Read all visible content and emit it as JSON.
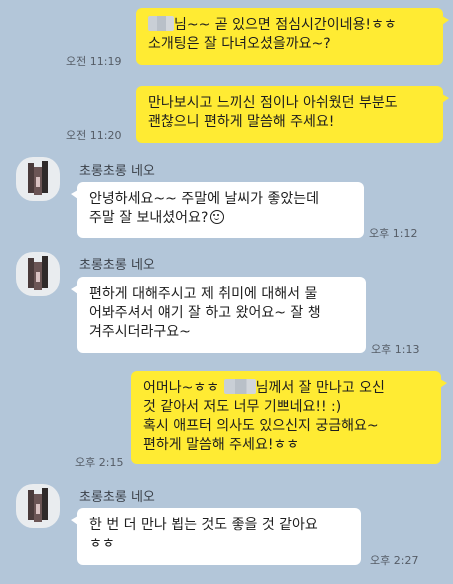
{
  "colors": {
    "background": "#b3c6d9",
    "my_bubble": "#ffeb33",
    "other_bubble": "#ffffff"
  },
  "messages": [
    {
      "from": "me",
      "line1_suffix": "님~~ 곧 있으면 점심시간이네용!ㅎㅎ",
      "line2": "소개팅은 잘 다녀오셨을까요~?",
      "time": "오전 11:19"
    },
    {
      "from": "me",
      "text": "만나보시고 느끼신 점이나 아쉬웠던 부분도\n괜찮으니 편하게 말씀해 주세요!",
      "time": "오전 11:20"
    },
    {
      "from": "other",
      "sender": "초롱초롱 네오",
      "text": "안녕하세요~~ 주말에 날씨가 좋았는데\n주말 잘 보내셨어요?",
      "emoji": "smile-emoji",
      "time": "오후 1:12"
    },
    {
      "from": "other",
      "sender": "초롱초롱 네오",
      "text": "편하게 대해주시고 제 취미에 대해서 물\n어봐주셔서 얘기 잘 하고 왔어요~ 잘 챙\n겨주시더라구요~",
      "time": "오후 1:13"
    },
    {
      "from": "me",
      "line1_prefix": "어머나~ㅎㅎ",
      "line1_suffix": "님께서 잘 만나고 오신",
      "rest": "것 같아서 저도 너무 기쁘네요!! :)\n혹시 애프터 의사도 있으신지 궁금해요~\n편하게 말씀해 주세요!ㅎㅎ",
      "time": "오후 2:15"
    },
    {
      "from": "other",
      "sender": "초롱초롱 네오",
      "text": "한 번 더 만나 뵙는 것도 좋을 것 같아요\nㅎㅎ",
      "time": "오후 2:27"
    }
  ]
}
